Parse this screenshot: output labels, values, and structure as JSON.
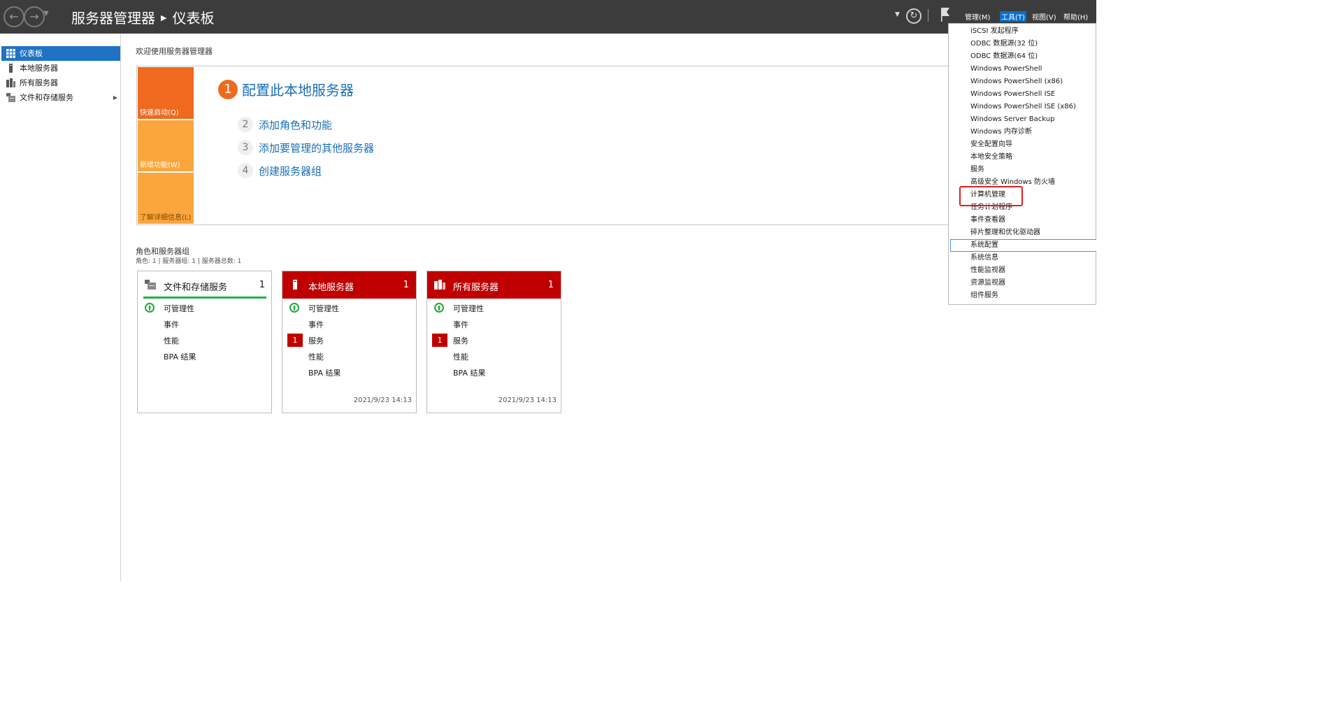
{
  "titlebar": {
    "app": "服务器管理器",
    "page": "仪表板",
    "menus": [
      {
        "label": "管理(M)"
      },
      {
        "label": "工具(T)"
      },
      {
        "label": "视图(V)"
      },
      {
        "label": "帮助(H)"
      }
    ]
  },
  "sidebar": {
    "items": [
      {
        "label": "仪表板",
        "icon": "dashboard-icon"
      },
      {
        "label": "本地服务器",
        "icon": "server-icon"
      },
      {
        "label": "所有服务器",
        "icon": "servers-icon"
      },
      {
        "label": "文件和存储服务",
        "icon": "storage-icon"
      }
    ]
  },
  "main": {
    "welcome": "欢迎使用服务器管理器",
    "tiles": [
      "快速启动(Q)",
      "新增功能(W)",
      "了解详细信息(L)"
    ],
    "steps": [
      {
        "num": "1",
        "label": "配置此本地服务器"
      },
      {
        "num": "2",
        "label": "添加角色和功能"
      },
      {
        "num": "3",
        "label": "添加要管理的其他服务器"
      },
      {
        "num": "4",
        "label": "创建服务器组"
      }
    ],
    "roles_title": "角色和服务器组",
    "roles_summary": "角色: 1 | 服务器组: 1 | 服务器总数: 1",
    "cards": [
      {
        "title": "文件和存储服务",
        "count": "1",
        "rows": [
          "可管理性",
          "事件",
          "性能",
          "BPA 结果"
        ],
        "timestamp": ""
      },
      {
        "title": "本地服务器",
        "count": "1",
        "rows": [
          "可管理性",
          "事件",
          "服务",
          "性能",
          "BPA 结果"
        ],
        "badge": "1",
        "timestamp": "2021/9/23 14:13"
      },
      {
        "title": "所有服务器",
        "count": "1",
        "rows": [
          "可管理性",
          "事件",
          "服务",
          "性能",
          "BPA 结果"
        ],
        "badge": "1",
        "timestamp": "2021/9/23 14:13"
      }
    ]
  },
  "tools_menu": {
    "items": [
      "iSCSI 发起程序",
      "ODBC 数据源(32 位)",
      "ODBC 数据源(64 位)",
      "Windows PowerShell",
      "Windows PowerShell (x86)",
      "Windows PowerShell ISE",
      "Windows PowerShell ISE (x86)",
      "Windows Server Backup",
      "Windows 内存诊断",
      "安全配置向导",
      "本地安全策略",
      "服务",
      "高级安全 Windows 防火墙",
      "计算机管理",
      "任务计划程序",
      "事件查看器",
      "碎片整理和优化驱动器",
      "系统配置",
      "系统信息",
      "性能监视器",
      "资源监视器",
      "组件服务"
    ]
  },
  "colors": {
    "titlebar_bg": "#3c3c3c",
    "accent_blue": "#1f73c4",
    "quickstart_orange": "#ef6a1f",
    "tile_orange": "#fba63c",
    "alert_red": "#c00000",
    "ok_green": "#22a83a",
    "highlight_red": "#e02020"
  }
}
